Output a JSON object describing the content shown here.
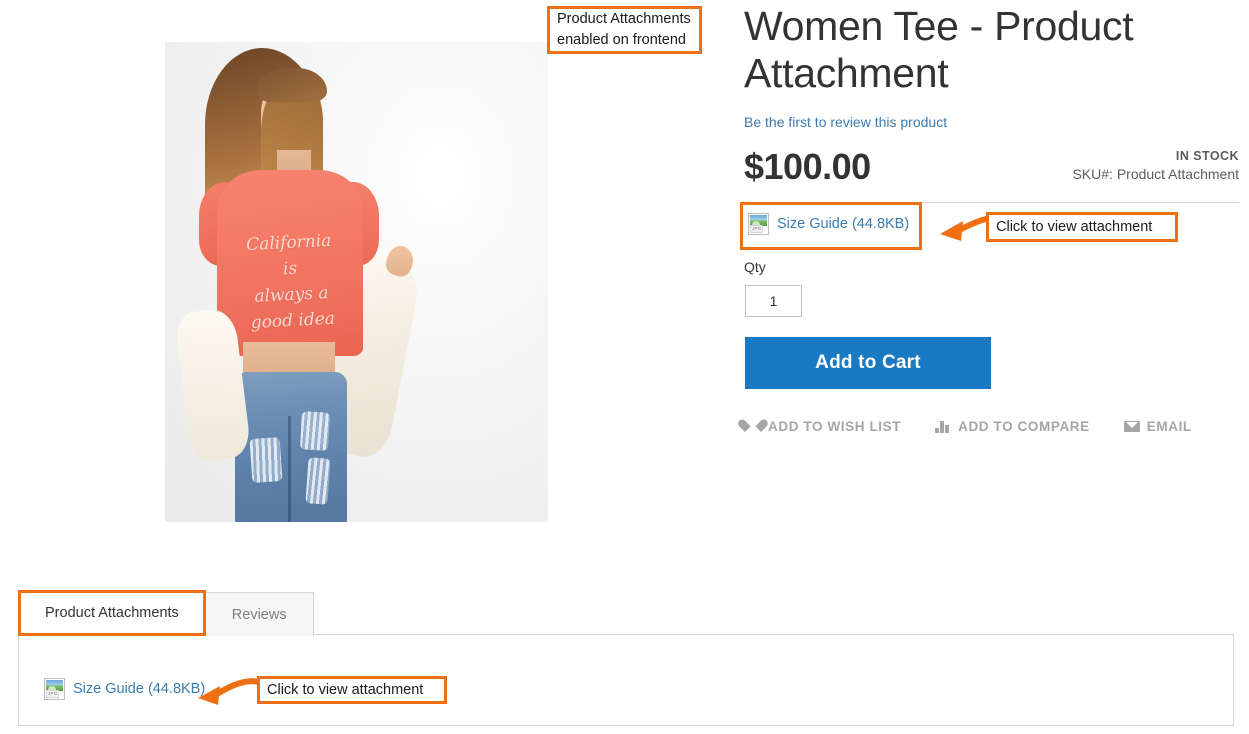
{
  "product": {
    "title": "Women Tee - Product Attachment",
    "review_link": "Be the first to review this product",
    "price": "$100.00",
    "stock_status": "IN STOCK",
    "sku_label": "SKU#:",
    "sku_value": "Product Attachment",
    "image_shirt_text": "California\nis\nalways a\ngood idea"
  },
  "attachment": {
    "label": "Size Guide (44.8KB)",
    "file_type": "JPG",
    "icon": "jpg-file-icon"
  },
  "qty": {
    "label": "Qty",
    "value": "1"
  },
  "add_to_cart": {
    "label": "Add to Cart",
    "color": "#1979c3"
  },
  "actions": [
    {
      "label": "ADD TO WISH LIST",
      "icon": "heart-icon"
    },
    {
      "label": "ADD TO COMPARE",
      "icon": "bar-chart-icon"
    },
    {
      "label": "EMAIL",
      "icon": "envelope-icon"
    }
  ],
  "tabs": [
    {
      "label": "Product Attachments",
      "active": true
    },
    {
      "label": "Reviews",
      "active": false
    }
  ],
  "annotations": {
    "enabled_frontend": "Product Attachments\nenabled on frontend",
    "click_view_top": "Click to view attachment",
    "click_view_bottom": "Click to view attachment",
    "accent_color": "#ef7012"
  }
}
